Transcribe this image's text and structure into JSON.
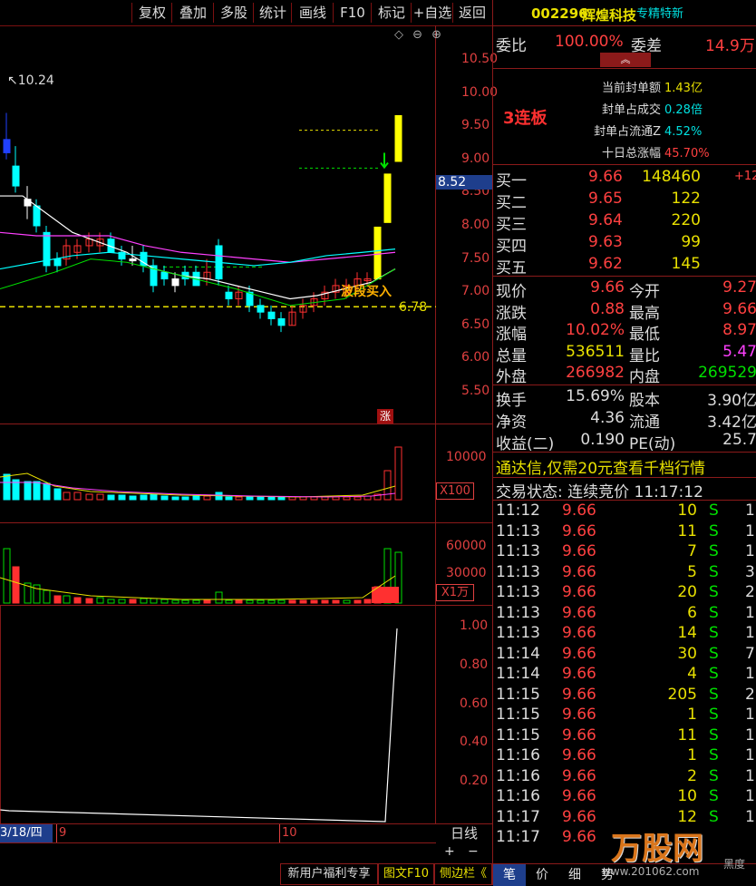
{
  "toolbar": {
    "buttons": [
      "复权",
      "叠加",
      "多股",
      "统计",
      "画线",
      "F10",
      "标记",
      "+自选",
      "返回"
    ]
  },
  "stock": {
    "code": "002296",
    "name": "辉煌科技",
    "tag": "专精特新",
    "label_10_24": "10.24",
    "streak": "3连板",
    "signal": "波段买入",
    "level_678": "6.78",
    "price_marker": "8.52",
    "zhang": "涨"
  },
  "price_axis": [
    "10.50",
    "10.00",
    "9.50",
    "9.00",
    "8.50",
    "8.00",
    "7.50",
    "7.00",
    "6.50",
    "6.00",
    "5.50"
  ],
  "vol_axis": {
    "tick": "10000",
    "unit": "X100"
  },
  "amt_axis": {
    "ticks": [
      "60000",
      "30000"
    ],
    "unit": "X1万"
  },
  "ind_axis": [
    "1.00",
    "0.80",
    "0.60",
    "0.40",
    "0.20"
  ],
  "date_axis": {
    "start": "3/18/四",
    "m9": "9",
    "m10": "10",
    "period": "日线"
  },
  "chart_controls": {
    "plus": "+",
    "minus": "−",
    "top_icons": "◇ ⊖ ⊕"
  },
  "weibi": {
    "label1": "委比",
    "val1": "100.00%",
    "label2": "委差",
    "val2": "14.9万"
  },
  "seal": {
    "items": [
      {
        "label": "当前封单额",
        "value": "1.43亿",
        "color": "#e8e000"
      },
      {
        "label": "封单占成交",
        "value": "0.28倍",
        "color": "#00e0e0"
      },
      {
        "label": "封单占流通Z",
        "value": "4.52%",
        "color": "#00e0e0"
      },
      {
        "label": "十日总涨幅",
        "value": "45.70%",
        "color": "#ff4040"
      }
    ]
  },
  "bids": [
    {
      "label": "买一",
      "price": "9.66",
      "vol": "148460",
      "extra": "+12"
    },
    {
      "label": "买二",
      "price": "9.65",
      "vol": "122",
      "extra": ""
    },
    {
      "label": "买三",
      "price": "9.64",
      "vol": "220",
      "extra": ""
    },
    {
      "label": "买四",
      "price": "9.63",
      "vol": "99",
      "extra": ""
    },
    {
      "label": "买五",
      "price": "9.62",
      "vol": "145",
      "extra": ""
    }
  ],
  "quote": [
    {
      "l1": "现价",
      "v1": "9.66",
      "c1": "#ff4040",
      "l2": "今开",
      "v2": "9.27",
      "c2": "#ff4040"
    },
    {
      "l1": "涨跌",
      "v1": "0.88",
      "c1": "#ff4040",
      "l2": "最高",
      "v2": "9.66",
      "c2": "#ff4040"
    },
    {
      "l1": "涨幅",
      "v1": "10.02%",
      "c1": "#ff4040",
      "l2": "最低",
      "v2": "8.97",
      "c2": "#ff4040"
    },
    {
      "l1": "总量",
      "v1": "536511",
      "c1": "#e8e000",
      "l2": "量比",
      "v2": "5.47",
      "c2": "#ff40ff"
    },
    {
      "l1": "外盘",
      "v1": "266982",
      "c1": "#ff4040",
      "l2": "内盘",
      "v2": "269529",
      "c2": "#00e000"
    }
  ],
  "fundamentals": [
    {
      "l1": "换手",
      "v1": "15.69%",
      "l2": "股本",
      "v2": "3.90亿"
    },
    {
      "l1": "净资",
      "v1": "4.36",
      "l2": "流通",
      "v2": "3.42亿"
    },
    {
      "l1": "收益(二)",
      "v1": "0.190",
      "l2": "PE(动)",
      "v2": "25.7"
    }
  ],
  "ad_text": "通达信,仅需20元查看千档行情",
  "trade_status": {
    "label": "交易状态:",
    "value": "连续竞价",
    "time": "11:17:12"
  },
  "ticks": [
    {
      "t": "11:12",
      "p": "9.66",
      "v": "10",
      "s": "S",
      "n": "1"
    },
    {
      "t": "11:13",
      "p": "9.66",
      "v": "11",
      "s": "S",
      "n": "1"
    },
    {
      "t": "11:13",
      "p": "9.66",
      "v": "7",
      "s": "S",
      "n": "1"
    },
    {
      "t": "11:13",
      "p": "9.66",
      "v": "5",
      "s": "S",
      "n": "3"
    },
    {
      "t": "11:13",
      "p": "9.66",
      "v": "20",
      "s": "S",
      "n": "2"
    },
    {
      "t": "11:13",
      "p": "9.66",
      "v": "6",
      "s": "S",
      "n": "1"
    },
    {
      "t": "11:13",
      "p": "9.66",
      "v": "14",
      "s": "S",
      "n": "1"
    },
    {
      "t": "11:14",
      "p": "9.66",
      "v": "30",
      "s": "S",
      "n": "7"
    },
    {
      "t": "11:14",
      "p": "9.66",
      "v": "4",
      "s": "S",
      "n": "1"
    },
    {
      "t": "11:15",
      "p": "9.66",
      "v": "205",
      "s": "S",
      "n": "2"
    },
    {
      "t": "11:15",
      "p": "9.66",
      "v": "1",
      "s": "S",
      "n": "1"
    },
    {
      "t": "11:15",
      "p": "9.66",
      "v": "11",
      "s": "S",
      "n": "1"
    },
    {
      "t": "11:16",
      "p": "9.66",
      "v": "1",
      "s": "S",
      "n": "1"
    },
    {
      "t": "11:16",
      "p": "9.66",
      "v": "2",
      "s": "S",
      "n": "1"
    },
    {
      "t": "11:16",
      "p": "9.66",
      "v": "10",
      "s": "S",
      "n": "1"
    },
    {
      "t": "11:17",
      "p": "9.66",
      "v": "12",
      "s": "S",
      "n": "1"
    },
    {
      "t": "11:17",
      "p": "9.66",
      "v": "",
      "s": "",
      "n": ""
    }
  ],
  "bottom_left": {
    "items": [
      "新用户福利专享",
      "图文F10",
      "侧边栏《"
    ]
  },
  "bottom_right": {
    "tabs": [
      "笔",
      "价",
      "细",
      "势"
    ]
  },
  "watermark": {
    "brand": "万股网",
    "url": "www.201062.com",
    "mark": "黑度"
  },
  "colors": {
    "up": "#ff3030",
    "down": "#00ffff",
    "grid": "#8b1a1a",
    "axis_text": "#e04040"
  }
}
